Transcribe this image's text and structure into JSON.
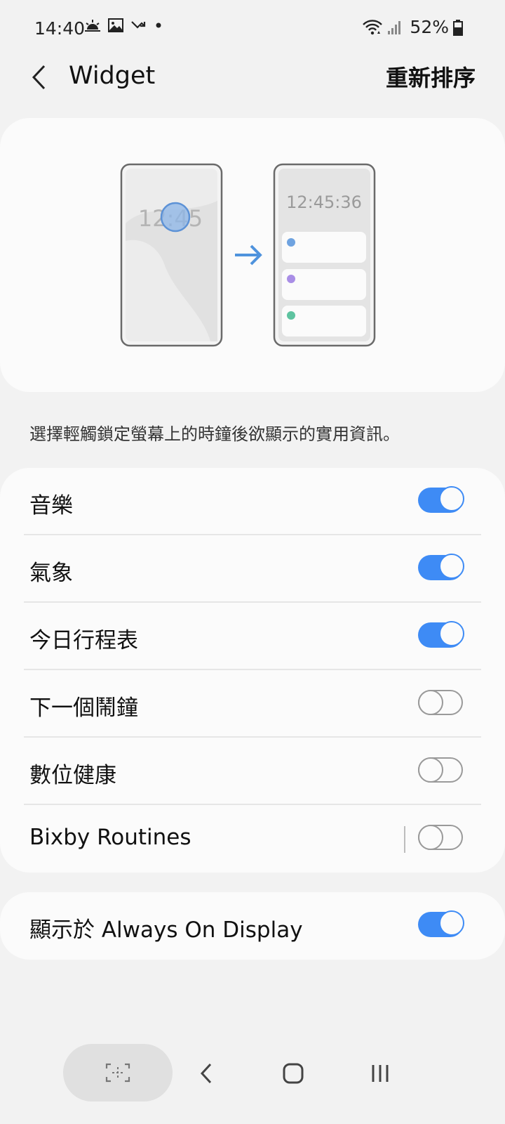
{
  "status_bar": {
    "time": "14:40",
    "battery": "52%",
    "icons": [
      "weather-sunrise-icon",
      "gallery-icon",
      "missed-call-icon",
      "dot-icon",
      "wifi-icon",
      "signal-icon",
      "battery-icon"
    ]
  },
  "header": {
    "title": "Widget",
    "reorder_label": "重新排序"
  },
  "illustration": {
    "left_clock": "12:45",
    "right_clock": "12:45:36",
    "dot_colors": [
      "#6fa3e0",
      "#a98ee6",
      "#5ec3a0"
    ]
  },
  "description": "選擇輕觸鎖定螢幕上的時鐘後欲顯示的實用資訊。",
  "widgets": [
    {
      "label": "音樂",
      "enabled": true
    },
    {
      "label": "氣象",
      "enabled": true
    },
    {
      "label": "今日行程表",
      "enabled": true
    },
    {
      "label": "下一個鬧鐘",
      "enabled": false
    },
    {
      "label": "數位健康",
      "enabled": false
    },
    {
      "label": "Bixby Routines",
      "enabled": false
    }
  ],
  "aod": {
    "label": "顯示於 Always On Display",
    "enabled": true
  },
  "colors": {
    "accent": "#3e8bf5",
    "card": "#fbfbfb",
    "background": "#f2f2f2"
  }
}
